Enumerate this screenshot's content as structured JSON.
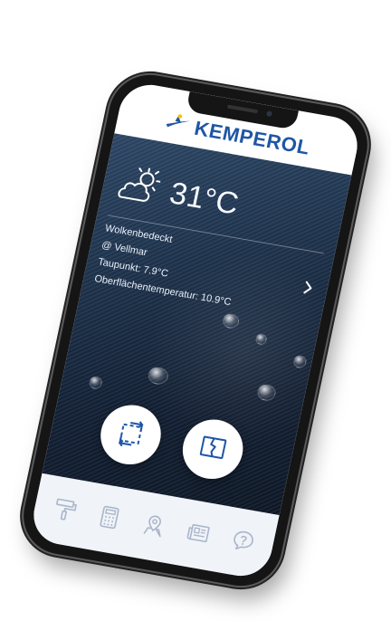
{
  "app": {
    "brand": "KEMPEROL"
  },
  "weather": {
    "icon": "partly-cloudy-icon",
    "temperature": "31°C",
    "condition": "Wolkenbedeckt",
    "location": "@ Vellmar",
    "dew_point": "Taupunkt: 7.9°C",
    "surface_temperature": "Oberflächentemperatur: 10.9°C"
  },
  "actions": [
    {
      "icon": "measure-area-icon"
    },
    {
      "icon": "crack-repair-icon"
    }
  ],
  "tabs": [
    {
      "icon": "paint-roller-icon"
    },
    {
      "icon": "calculator-icon"
    },
    {
      "icon": "map-pin-icon"
    },
    {
      "icon": "newspaper-icon"
    },
    {
      "icon": "help-icon"
    }
  ],
  "colors": {
    "brand_blue": "#1f56a6",
    "tab_icon": "#a9b6c9"
  }
}
